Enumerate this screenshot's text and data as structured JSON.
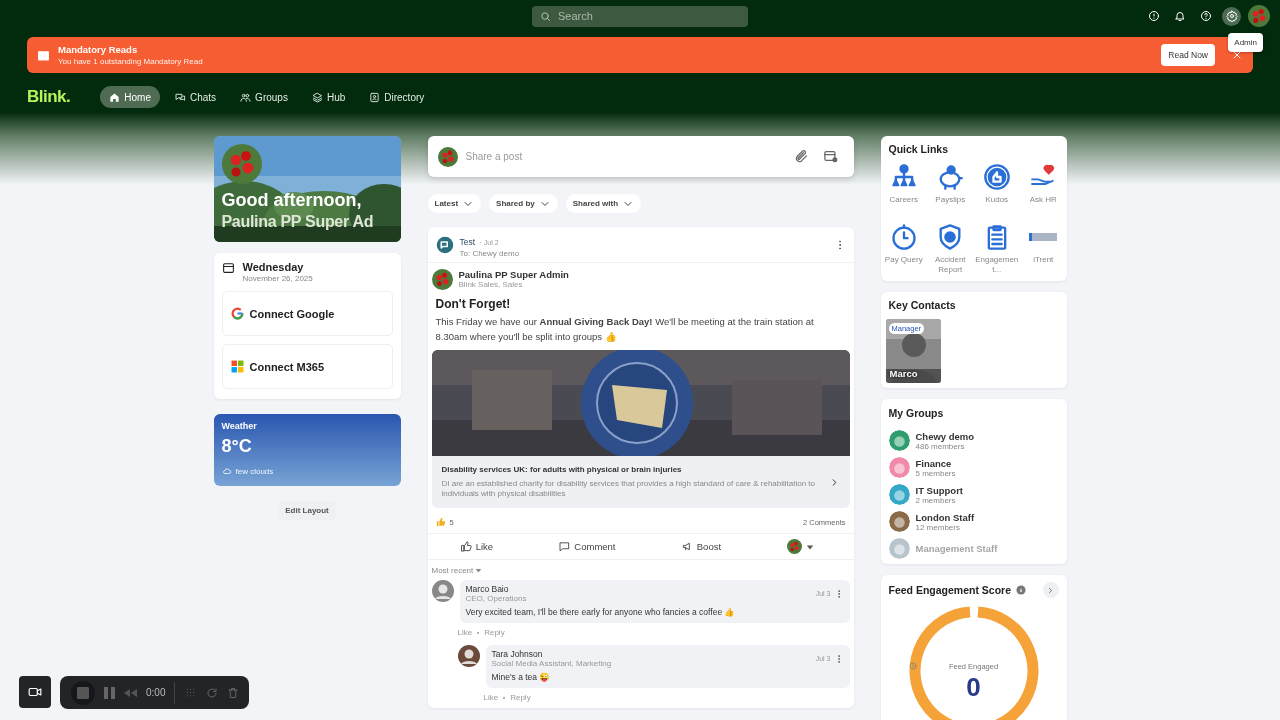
{
  "topbar": {
    "search": {
      "placeholder": "Search"
    },
    "tooltip": "Admin"
  },
  "banner": {
    "title": "Mandatory Reads",
    "subtitle": "You have 1 outstanding Mandatory Read",
    "button": "Read Now"
  },
  "nav": {
    "logo": "Blink.",
    "items": [
      {
        "label": "Home",
        "selected": true
      },
      {
        "label": "Chats",
        "selected": false
      },
      {
        "label": "Groups",
        "selected": false
      },
      {
        "label": "Hub",
        "selected": false
      },
      {
        "label": "Directory",
        "selected": false
      }
    ]
  },
  "greeting": {
    "line1": "Good afternoon,",
    "line2": "Paulina PP Super Ad"
  },
  "calendar": {
    "day": "Wednesday",
    "date": "November 26, 2025",
    "connect": [
      "Connect Google",
      "Connect M365"
    ]
  },
  "weather": {
    "title": "Weather",
    "temperature": "8°C",
    "description": "few clouds"
  },
  "edit_layout": "Edit Layout",
  "composer": {
    "placeholder": "Share a post"
  },
  "filters": [
    "Latest",
    "Shared by",
    "Shared with"
  ],
  "post": {
    "source": "Test",
    "date": "· Jul 2",
    "audience": "To: Chewy demo",
    "author": "Paulina PP Super Admin",
    "department": "Blink Sales, Sales",
    "title": "Don't Forget!",
    "body": "This Friday we have our **Annual Giving Back Day!** We'll be meeting at the train station at 8.30am where you'll be split into groups 👍",
    "link": {
      "title": "Disability services UK: for adults with physical or brain injuries",
      "description": "DI are an established charity for disability services that provides a high standard of care & rehabilitation to individuals with physical disabilities"
    },
    "reactions": "5",
    "comment_count": "2 Comments",
    "actions": [
      "Like",
      "Comment",
      "Boost"
    ],
    "sort": "Most recent",
    "comments": [
      {
        "author": "Marco Baio",
        "role": "CEO, Operations",
        "date": "Jul 3",
        "text": "Very excited team, I'll be there early for anyone who fancies a coffee 👍",
        "actions": [
          "Like",
          "Reply"
        ],
        "children": [
          {
            "author": "Tara Johnson",
            "role": "Social Media Assistant, Marketing",
            "date": "Jul 3",
            "text": "Mine's a tea 😜",
            "actions": [
              "Like",
              "Reply"
            ]
          }
        ]
      }
    ]
  },
  "quick_links": {
    "title": "Quick Links",
    "items": [
      "Careers",
      "Payslips",
      "Kudos",
      "Ask HR",
      "Pay Query",
      "Accident Report",
      "Engagement...",
      "iTrent"
    ]
  },
  "key_contacts": {
    "title": "Key Contacts",
    "contacts": [
      {
        "badge": "Manager",
        "name": "Marco"
      }
    ]
  },
  "my_groups": {
    "title": "My Groups",
    "groups": [
      {
        "name": "Chewy demo",
        "members": "486 members",
        "color": "#2f9e6e"
      },
      {
        "name": "Finance",
        "members": "5 members",
        "color": "#f08aa8"
      },
      {
        "name": "IT Support",
        "members": "2 members",
        "color": "#35a8c8"
      },
      {
        "name": "London Staff",
        "members": "12 members",
        "color": "#8a6a48"
      },
      {
        "name": "Management Staff",
        "faded": true,
        "color": "#b8c4cc"
      }
    ]
  },
  "feed_score": {
    "title": "Feed Engagement Score",
    "label": "Feed Engaged",
    "value": "0"
  },
  "recorder": {
    "time": "0:00"
  }
}
